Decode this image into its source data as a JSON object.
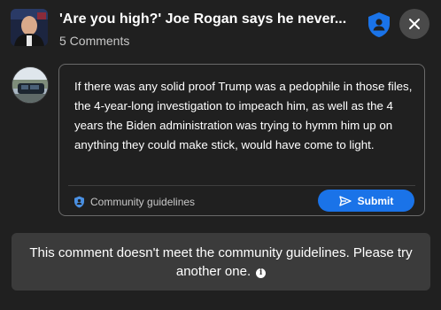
{
  "article": {
    "title": "'Are you high?' Joe Rogan says he never...",
    "comments_count": "5 Comments"
  },
  "icons": {
    "shield": "shield-person-icon",
    "close": "close-icon",
    "guidelines": "shield-icon",
    "submit": "send-icon",
    "info": "info-icon"
  },
  "comment": {
    "text": "If there was any solid proof Trump was a pedophile in those files, the 4-year-long investigation to impeach him, as well as the 4 years the Biden administration was trying to hymm him up on anything they could make stick, would have come to light."
  },
  "footer": {
    "guidelines_label": "Community guidelines",
    "submit_label": "Submit"
  },
  "error": {
    "message": "This comment doesn't meet the community guidelines. Please try another one.",
    "info_glyph": "i"
  },
  "colors": {
    "background": "#202020",
    "accent": "#1a73e8",
    "panel": "#3b3b3b"
  }
}
